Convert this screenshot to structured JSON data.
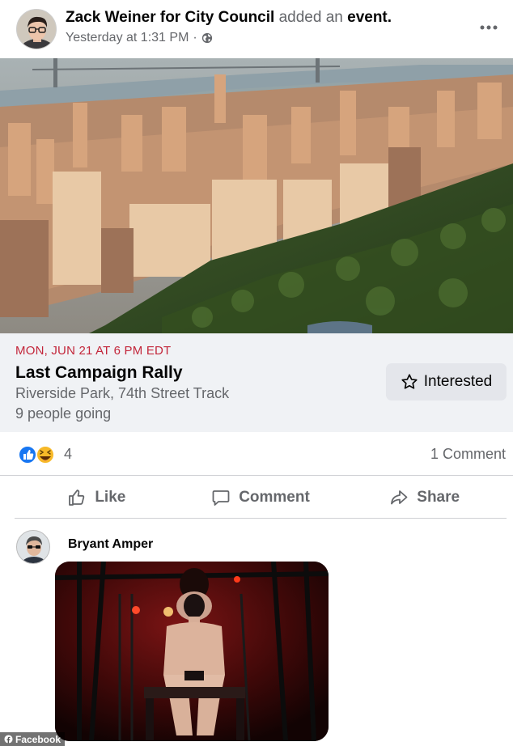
{
  "post": {
    "author": "Zack Weiner for City Council",
    "action": "added an",
    "object": "event.",
    "timestamp": "Yesterday at 1:31 PM",
    "separator": "·",
    "privacy_icon": "globe-icon",
    "more_icon": "more-horizontal-icon"
  },
  "event": {
    "date": "MON, JUN 21 AT 6 PM EDT",
    "title": "Last Campaign Rally",
    "location": "Riverside Park, 74th Street Track",
    "going": "9 people going",
    "interested_label": "Interested"
  },
  "reactions": {
    "types": [
      "like",
      "haha"
    ],
    "count": "4",
    "comments": "1 Comment"
  },
  "actions": {
    "like": "Like",
    "comment": "Comment",
    "share": "Share"
  },
  "comment": {
    "author": "Bryant Amper"
  },
  "watermark": "Facebook",
  "colors": {
    "date_red": "#c3263a",
    "secondary_text": "#65676b",
    "like_blue": "#1877f2",
    "haha_yellow": "#f7b928",
    "card_bg": "#f0f2f5"
  }
}
